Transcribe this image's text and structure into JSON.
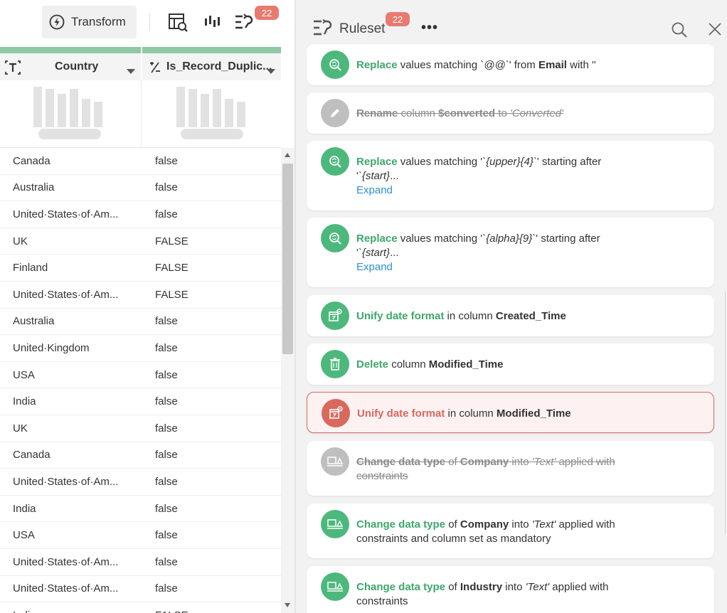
{
  "toolbar": {
    "transform_label": "Transform",
    "badge_count": "22"
  },
  "columns": [
    {
      "name": "Country",
      "type_icon": "text-type-icon"
    },
    {
      "name": "Is_Record_Duplic...",
      "type_icon": "boolean-type-icon"
    }
  ],
  "rows": [
    {
      "country": "Canada",
      "dup": "false"
    },
    {
      "country": "Australia",
      "dup": "false"
    },
    {
      "country": "United·States·of·Am...",
      "dup": "false"
    },
    {
      "country": "UK",
      "dup": "FALSE"
    },
    {
      "country": "Finland",
      "dup": "FALSE"
    },
    {
      "country": "United·States·of·Am...",
      "dup": "FALSE"
    },
    {
      "country": "Australia",
      "dup": "false"
    },
    {
      "country": "United·Kingdom",
      "dup": "false"
    },
    {
      "country": "USA",
      "dup": "false"
    },
    {
      "country": "India",
      "dup": "false"
    },
    {
      "country": "UK",
      "dup": "false"
    },
    {
      "country": "Canada",
      "dup": "false"
    },
    {
      "country": "United·States·of·Am...",
      "dup": "false"
    },
    {
      "country": "India",
      "dup": "false"
    },
    {
      "country": "USA",
      "dup": "false"
    },
    {
      "country": "United·States·of·Am...",
      "dup": "false"
    },
    {
      "country": "United·States·of·Am...",
      "dup": "false"
    },
    {
      "country": "India",
      "dup": "FALSE"
    }
  ],
  "ruleset": {
    "title": "Ruleset",
    "badge_count": "22",
    "more_label": "•••",
    "rules": [
      {
        "action": "Replace",
        "t1": " values matching ",
        "code1": "`@@`",
        "t2": "' from ",
        "obj1": "Email",
        "t3": " with ''",
        "status": "normal"
      },
      {
        "action": "Rename",
        "t1": " column ",
        "obj1": "$converted",
        "t2": " to ",
        "code1": "'Converted'",
        "status": "disabled"
      },
      {
        "action": "Replace",
        "t1": " values matching '",
        "code1": "`{upper}{4}`",
        "t2": "' starting after '",
        "code2": "`{start}",
        "t3": "...",
        "expand": "Expand",
        "status": "normal"
      },
      {
        "action": "Replace",
        "t1": " values matching '",
        "code1": "`{alpha}{9}`",
        "t2": "' starting after '",
        "code2": "`{start}",
        "t3": "...",
        "expand": "Expand",
        "status": "normal"
      },
      {
        "action": "Unify date format",
        "t1": " in column ",
        "obj1": "Created_Time",
        "status": "normal"
      },
      {
        "action": "Delete",
        "t1": " column ",
        "obj1": "Modified_Time",
        "status": "normal"
      },
      {
        "action": "Unify date format",
        "t1": " in column ",
        "obj1": "Modified_Time",
        "status": "error"
      },
      {
        "action": "Change data type",
        "t1": " of ",
        "obj1": "Company",
        "t2": " into ",
        "code1": "'Text'",
        "t3": " applied with constraints",
        "status": "disabled"
      },
      {
        "action": "Change data type",
        "t1": " of ",
        "obj1": "Company",
        "t2": " into ",
        "code1": "'Text'",
        "t3": " applied with constraints and column set as mandatory",
        "status": "normal"
      },
      {
        "action": "Change data type",
        "t1": " of ",
        "obj1": "Industry",
        "t2": " into ",
        "code1": "'Text'",
        "t3": " applied with constraints",
        "status": "normal"
      }
    ]
  },
  "colors": {
    "accent_green": "#4db87c",
    "error_red": "#d9685e",
    "badge": "#e97a6f",
    "link": "#2b91d1"
  }
}
